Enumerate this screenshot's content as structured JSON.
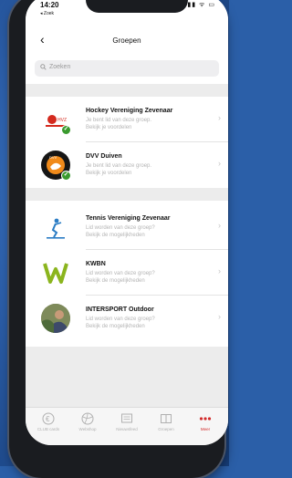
{
  "status_bar": {
    "time": "14:20",
    "back_app": "◂ Zoek",
    "icons": "▮▮ ᯤ ▭"
  },
  "nav": {
    "title": "Groepen",
    "back_glyph": "‹"
  },
  "search": {
    "placeholder": "Zoeken"
  },
  "groups": [
    {
      "name": "Hockey Vereniging Zevenaar",
      "line1": "Je bent lid van deze groep.",
      "line2": "Bekijk je voordelen",
      "member": true
    },
    {
      "name": "DVV Duiven",
      "line1": "Je bent lid van deze groep.",
      "line2": "Bekijk je voordelen",
      "member": true
    },
    {
      "name": "Tennis Vereniging Zevenaar",
      "line1": "Lid worden van deze groep?",
      "line2": "Bekijk de mogelijkheden",
      "member": false
    },
    {
      "name": "KWBN",
      "line1": "Lid worden van deze groep?",
      "line2": "Bekijk de mogelijkheden",
      "member": false
    },
    {
      "name": "INTERSPORT Outdoor",
      "line1": "Lid worden van deze groep?",
      "line2": "Bekijk de mogelijkheden",
      "member": false
    }
  ],
  "tabs": [
    {
      "label": "CLUB cards",
      "icon": "euro-icon"
    },
    {
      "label": "Webshop",
      "icon": "ball-icon"
    },
    {
      "label": "Nieuwsfeed",
      "icon": "news-icon"
    },
    {
      "label": "Groepen",
      "icon": "book-icon"
    },
    {
      "label": "Meer",
      "icon": "more-dots-icon",
      "active": true
    }
  ],
  "colors": {
    "accent": "#d22a2a",
    "member_check": "#3a9a2e",
    "background": "#2b5fa8"
  }
}
